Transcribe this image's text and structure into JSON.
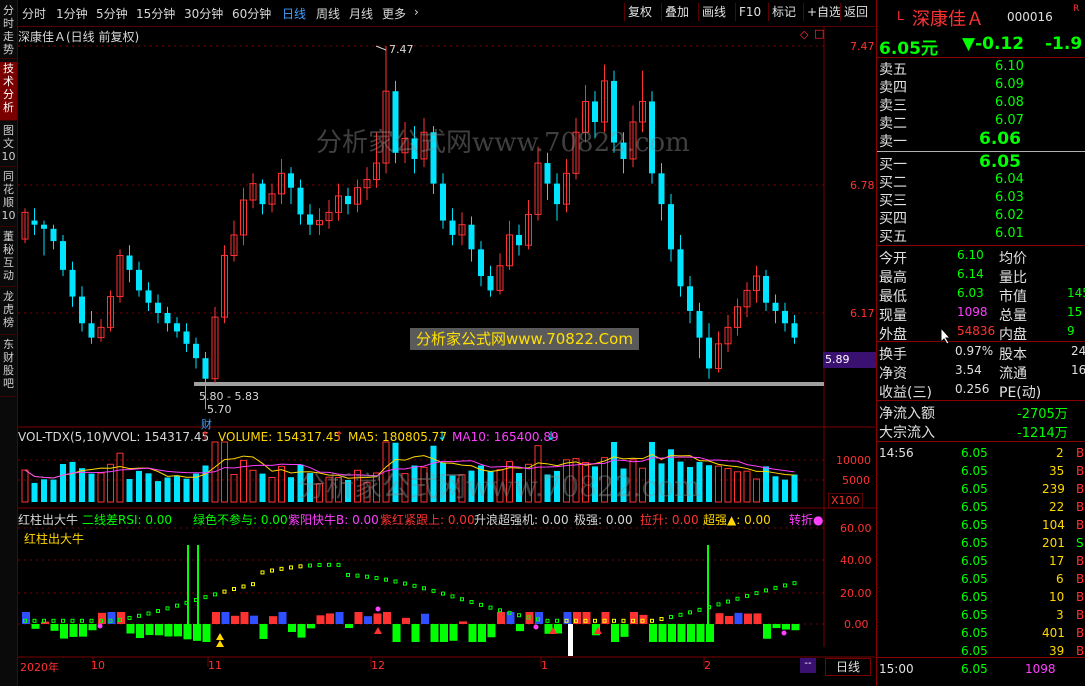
{
  "toolbar": {
    "periods": [
      "分时",
      "1分钟",
      "5分钟",
      "15分钟",
      "30分钟",
      "60分钟",
      "日线",
      "周线",
      "月线",
      "更多"
    ],
    "more_arrow": "›",
    "actions": [
      "复权",
      "叠加",
      "画线",
      "F10",
      "标记",
      "+自选",
      "返回"
    ]
  },
  "sidebar": [
    "分时走势",
    "技术分析",
    "图文10",
    "同花顺10",
    "董秘互动",
    "龙虎榜",
    "东财股吧"
  ],
  "chart": {
    "title": "深康佳Ａ(日线 前复权)",
    "high_label": "7.47",
    "low_label1": "5.80 - 5.83",
    "low_label2": "5.70",
    "cai_label": "财",
    "price_ticks": [
      "7.47",
      "6.78",
      "6.17"
    ],
    "current_price_tag": "5.89",
    "watermark1": "分析家公式网www.70822.com",
    "watermark2": "分析家公式网www.70822.Com",
    "watermark3": "分析家公式网www.70822.com",
    "vol_header": {
      "name": "VOL-TDX(5,10)",
      "vvol": "VVOL: 154317.45",
      "volume": "VOLUME: 154317.45",
      "ma5": "MA5: 180805.77",
      "ma10": "MA10: 165400.89"
    },
    "vol_ticks": [
      "10000",
      "5000"
    ],
    "vol_unit": "X100",
    "ind_header": [
      "红柱出大牛",
      "二线差RSI: 0.00",
      "绿色不参与: 0.00",
      "紫阳快牛B: 0.00",
      "紫红紧跟上: 0.00",
      "升浪超强机: 0.00",
      "极强: 0.00",
      "拉升: 0.00",
      "超强▲: 0.00",
      "转折●"
    ],
    "ind_sub": "红柱出大牛",
    "ind_ticks": [
      "60.00",
      "40.00",
      "20.00",
      "0.00"
    ],
    "x_axis": [
      "2020年",
      "10",
      "11",
      "12",
      "1",
      "2"
    ],
    "period_tab": "日线",
    "period_dash": "--",
    "colors": {
      "up": "#ff3232",
      "down": "#00e5ff",
      "bg": "#000000",
      "grid": "#7a0000",
      "green": "#00ff00",
      "yellow": "#ffff00",
      "magenta": "#ff40ff"
    },
    "candles": [
      [
        6.53,
        6.66,
        6.51,
        6.68
      ],
      [
        6.62,
        6.6,
        6.55,
        6.68
      ],
      [
        6.6,
        6.58,
        6.45,
        6.62
      ],
      [
        6.58,
        6.52,
        6.48,
        6.6
      ],
      [
        6.52,
        6.38,
        6.35,
        6.55
      ],
      [
        6.38,
        6.25,
        6.2,
        6.42
      ],
      [
        6.25,
        6.12,
        6.08,
        6.3
      ],
      [
        6.12,
        6.05,
        6.02,
        6.18
      ],
      [
        6.05,
        6.1,
        6.03,
        6.14
      ],
      [
        6.1,
        6.25,
        6.08,
        6.28
      ],
      [
        6.25,
        6.45,
        6.22,
        6.48
      ],
      [
        6.45,
        6.38,
        6.32,
        6.5
      ],
      [
        6.38,
        6.28,
        6.25,
        6.42
      ],
      [
        6.28,
        6.22,
        6.18,
        6.32
      ],
      [
        6.22,
        6.17,
        6.12,
        6.26
      ],
      [
        6.17,
        6.12,
        6.08,
        6.2
      ],
      [
        6.12,
        6.08,
        6.05,
        6.15
      ],
      [
        6.08,
        6.02,
        5.98,
        6.12
      ],
      [
        6.02,
        5.95,
        5.9,
        6.05
      ],
      [
        5.95,
        5.85,
        5.7,
        5.98
      ],
      [
        5.85,
        6.15,
        5.83,
        6.2
      ],
      [
        6.15,
        6.45,
        6.12,
        6.5
      ],
      [
        6.45,
        6.55,
        6.42,
        6.62
      ],
      [
        6.55,
        6.72,
        6.5,
        6.78
      ],
      [
        6.72,
        6.8,
        6.68,
        6.85
      ],
      [
        6.8,
        6.7,
        6.65,
        6.82
      ],
      [
        6.7,
        6.75,
        6.66,
        6.8
      ],
      [
        6.75,
        6.85,
        6.7,
        6.92
      ],
      [
        6.85,
        6.78,
        6.7,
        6.88
      ],
      [
        6.78,
        6.65,
        6.6,
        6.82
      ],
      [
        6.65,
        6.6,
        6.55,
        6.7
      ],
      [
        6.6,
        6.62,
        6.55,
        6.68
      ],
      [
        6.62,
        6.66,
        6.58,
        6.72
      ],
      [
        6.66,
        6.74,
        6.62,
        6.8
      ],
      [
        6.74,
        6.7,
        6.65,
        6.78
      ],
      [
        6.7,
        6.78,
        6.66,
        6.82
      ],
      [
        6.78,
        6.82,
        6.72,
        6.88
      ],
      [
        6.82,
        6.9,
        6.78,
        7.05
      ],
      [
        6.9,
        7.25,
        6.85,
        7.47
      ],
      [
        7.25,
        6.95,
        6.9,
        7.3
      ],
      [
        6.95,
        7.02,
        6.9,
        7.1
      ],
      [
        7.02,
        6.92,
        6.85,
        7.08
      ],
      [
        6.92,
        7.05,
        6.88,
        7.12
      ],
      [
        7.05,
        6.8,
        6.75,
        7.08
      ],
      [
        6.8,
        6.62,
        6.58,
        6.85
      ],
      [
        6.62,
        6.55,
        6.5,
        6.68
      ],
      [
        6.55,
        6.6,
        6.5,
        6.66
      ],
      [
        6.6,
        6.48,
        6.42,
        6.64
      ],
      [
        6.48,
        6.35,
        6.3,
        6.52
      ],
      [
        6.35,
        6.28,
        6.25,
        6.4
      ],
      [
        6.28,
        6.4,
        6.26,
        6.46
      ],
      [
        6.4,
        6.55,
        6.38,
        6.62
      ],
      [
        6.55,
        6.5,
        6.45,
        6.6
      ],
      [
        6.5,
        6.65,
        6.48,
        6.72
      ],
      [
        6.65,
        6.9,
        6.62,
        6.98
      ],
      [
        6.9,
        6.8,
        6.72,
        6.95
      ],
      [
        6.8,
        6.7,
        6.62,
        6.85
      ],
      [
        6.7,
        6.85,
        6.66,
        6.92
      ],
      [
        6.85,
        7.05,
        6.82,
        7.12
      ],
      [
        7.05,
        7.2,
        7.0,
        7.28
      ],
      [
        7.2,
        7.1,
        7.02,
        7.25
      ],
      [
        7.1,
        7.3,
        7.05,
        7.38
      ],
      [
        7.3,
        7.0,
        6.95,
        7.35
      ],
      [
        7.0,
        6.92,
        6.85,
        7.05
      ],
      [
        6.92,
        7.1,
        6.88,
        7.18
      ],
      [
        7.1,
        7.2,
        7.05,
        7.35
      ],
      [
        7.2,
        6.85,
        6.8,
        7.25
      ],
      [
        6.85,
        6.7,
        6.62,
        6.9
      ],
      [
        6.7,
        6.48,
        6.42,
        6.75
      ],
      [
        6.48,
        6.3,
        6.25,
        6.55
      ],
      [
        6.3,
        6.18,
        6.12,
        6.35
      ],
      [
        6.18,
        6.05,
        5.95,
        6.22
      ],
      [
        6.05,
        5.9,
        5.85,
        6.12
      ],
      [
        5.9,
        6.02,
        5.88,
        6.08
      ],
      [
        6.02,
        6.1,
        5.98,
        6.16
      ],
      [
        6.1,
        6.2,
        6.06,
        6.24
      ],
      [
        6.2,
        6.28,
        6.15,
        6.32
      ],
      [
        6.28,
        6.35,
        6.22,
        6.4
      ],
      [
        6.35,
        6.22,
        6.18,
        6.38
      ],
      [
        6.22,
        6.18,
        6.12,
        6.26
      ],
      [
        6.18,
        6.12,
        6.08,
        6.22
      ],
      [
        6.12,
        6.05,
        6.02,
        6.16
      ]
    ]
  },
  "quote": {
    "market_badge": "L",
    "name": "深康佳Ａ",
    "code": "000016",
    "flag": "R",
    "price": "6.05元",
    "change": "▼-0.12",
    "change_pct": "-1.9",
    "asks": [
      [
        "卖五",
        "6.10"
      ],
      [
        "卖四",
        "6.09"
      ],
      [
        "卖三",
        "6.08"
      ],
      [
        "卖二",
        "6.07"
      ],
      [
        "卖一",
        "6.06"
      ]
    ],
    "bids": [
      [
        "买一",
        "6.05"
      ],
      [
        "买二",
        "6.04"
      ],
      [
        "买三",
        "6.03"
      ],
      [
        "买四",
        "6.02"
      ],
      [
        "买五",
        "6.01"
      ]
    ],
    "stats": [
      [
        "今开",
        "6.10",
        "均价",
        ""
      ],
      [
        "最高",
        "6.14",
        "量比",
        ""
      ],
      [
        "最低",
        "6.03",
        "市值",
        "145"
      ],
      [
        "现量",
        "1098",
        "总量",
        "15"
      ],
      [
        "外盘",
        "54836",
        "内盘",
        "9"
      ]
    ],
    "stats2": [
      [
        "换手",
        "0.97%",
        "股本",
        "24"
      ],
      [
        "净资",
        "3.54",
        "流通",
        "16"
      ],
      [
        "收益(三)",
        "0.256",
        "PE(动)",
        ""
      ]
    ],
    "flows": [
      [
        "净流入额",
        "-2705万"
      ],
      [
        "大宗流入",
        "-1214万"
      ]
    ],
    "ticks_time": "14:56",
    "ticks": [
      [
        "6.05",
        "2",
        "B"
      ],
      [
        "6.05",
        "35",
        "B"
      ],
      [
        "6.05",
        "239",
        "B"
      ],
      [
        "6.05",
        "22",
        "B"
      ],
      [
        "6.05",
        "104",
        "B"
      ],
      [
        "6.05",
        "201",
        "S"
      ],
      [
        "6.05",
        "17",
        "B"
      ],
      [
        "6.05",
        "6",
        "B"
      ],
      [
        "6.05",
        "10",
        "B"
      ],
      [
        "6.05",
        "3",
        "B"
      ],
      [
        "6.05",
        "401",
        "B"
      ],
      [
        "6.05",
        "39",
        "B"
      ]
    ],
    "last_tick": [
      "15:00",
      "6.05",
      "1098"
    ]
  }
}
